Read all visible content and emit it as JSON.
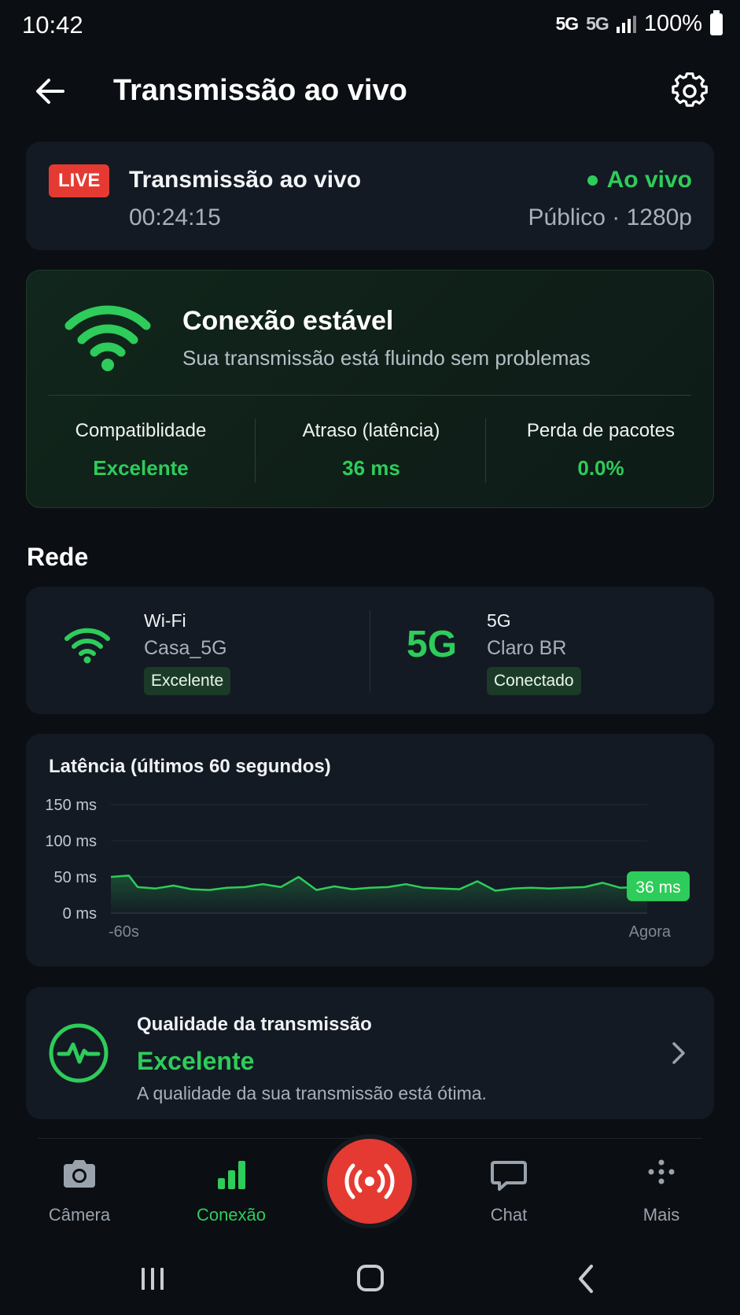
{
  "status_bar": {
    "time": "10:42",
    "network1": "5G",
    "network2": "5G",
    "battery": "100%"
  },
  "app_bar": {
    "title": "Transmissão ao vivo"
  },
  "live_card": {
    "badge": "LIVE",
    "title": "Transmissão ao vivo",
    "timer": "00:24:15",
    "status": "Ao vivo",
    "info": "Público · 1280p"
  },
  "stability": {
    "title": "Conexão estável",
    "subtitle": "Sua transmissão está fluindo sem problemas",
    "metrics": [
      {
        "label": "Compatiblidade",
        "value": "Excelente"
      },
      {
        "label": "Atraso (latência)",
        "value": "36 ms"
      },
      {
        "label": "Perda de pacotes",
        "value": "0.0%"
      }
    ]
  },
  "network": {
    "section_title": "Rede",
    "wifi": {
      "type": "Wi-Fi",
      "name": "Casa_5G",
      "badge": "Excelente"
    },
    "cellular": {
      "logo": "5G",
      "type": "5G",
      "name": "Claro BR",
      "badge": "Conectado"
    }
  },
  "latency_chart": {
    "title": "Latência (últimos 60 segundos)",
    "current_label": "36 ms",
    "chart_data": {
      "type": "area",
      "title": "Latência (últimos 60 segundos)",
      "y_ticks": [
        "150 ms",
        "100 ms",
        "50 ms",
        "0 ms"
      ],
      "ylim": [
        0,
        150
      ],
      "x_labels": [
        "-60s",
        "Agora"
      ],
      "xlim": [
        -60,
        0
      ],
      "x": [
        -60,
        -58,
        -57,
        -55,
        -53,
        -51,
        -49,
        -47,
        -45,
        -43,
        -41,
        -39,
        -37,
        -35,
        -33,
        -31,
        -29,
        -27,
        -25,
        -23,
        -21,
        -19,
        -17,
        -15,
        -13,
        -11,
        -9,
        -7,
        -5,
        -3,
        -1,
        0
      ],
      "values": [
        50,
        52,
        36,
        34,
        38,
        33,
        32,
        35,
        36,
        40,
        36,
        50,
        32,
        37,
        33,
        35,
        36,
        40,
        35,
        34,
        33,
        44,
        31,
        34,
        35,
        34,
        35,
        36,
        42,
        35,
        36,
        36
      ],
      "grid": true,
      "color": "#2ecc5a"
    }
  },
  "quality": {
    "label": "Qualidade da transmissão",
    "value": "Excelente",
    "description": "A qualidade da sua transmissão está ótima."
  },
  "bottom_nav": {
    "items": [
      {
        "label": "Câmera",
        "icon": "camera-icon"
      },
      {
        "label": "Conexão",
        "icon": "signal-bars-icon"
      },
      {
        "label": "Chat",
        "icon": "chat-icon"
      },
      {
        "label": "Mais",
        "icon": "more-dots-icon"
      }
    ],
    "fab_icon": "broadcast-icon"
  },
  "colors": {
    "accent": "#2ecc5a",
    "live_red": "#e53a32",
    "background": "#0b0e13",
    "card": "#131a23"
  }
}
